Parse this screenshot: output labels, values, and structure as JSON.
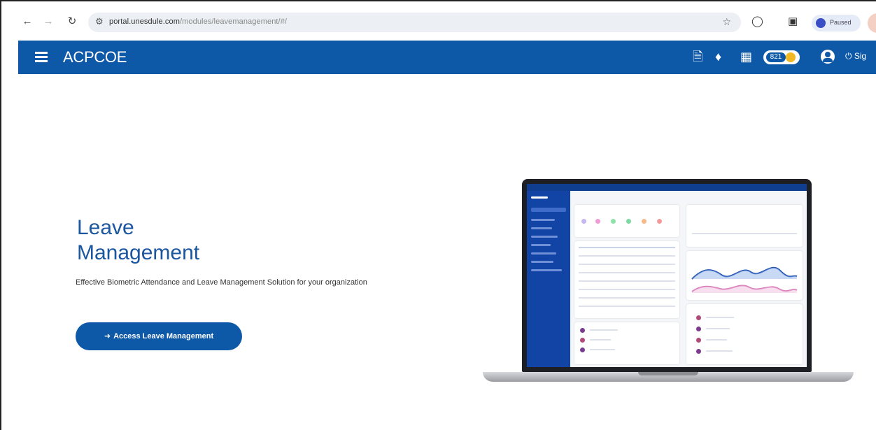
{
  "browser": {
    "url_domain": "portal.unesdule.com",
    "url_path": "/modules/leavemanagement/#/",
    "profile_label": "Paused"
  },
  "header": {
    "brand": "ACPCOE",
    "coins": "821",
    "signout_label": "Sig"
  },
  "hero": {
    "title_line1": "Leave",
    "title_line2": "Management",
    "subtitle": "Effective Biometric Attendance and Leave Management Solution for your organization",
    "cta_label": "Access Leave Management"
  },
  "colors": {
    "brand_blue": "#0e58a8",
    "title_blue": "#1b56a0"
  },
  "icons": {
    "back": "arrow-left-icon",
    "forward": "arrow-right-icon",
    "reload": "reload-icon",
    "site_info": "tune-icon",
    "bookmark": "star-icon",
    "extensions": "puzzle-icon",
    "side_panel": "side-panel-icon",
    "menu": "hamburger-menu-icon",
    "document": "document-icon",
    "notification": "bell-icon",
    "apps": "grid-icon",
    "account": "account-circle-icon",
    "power": "power-icon",
    "login": "login-icon"
  }
}
